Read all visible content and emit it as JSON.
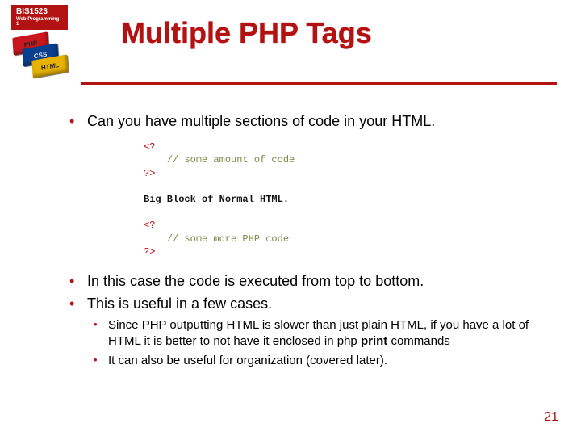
{
  "course": {
    "code": "BIS1523",
    "subtitle": "Web Programming 1"
  },
  "logo_bricks": [
    "PHP",
    "CSS",
    "HTML"
  ],
  "title": "Multiple PHP Tags",
  "bullets": {
    "b1": "Can you have multiple sections of code in your HTML.",
    "b2": "In this case the code is executed from top to bottom.",
    "b3": "This is useful in a few cases.",
    "sub1_pre": "Since PHP outputting HTML is slower than just plain HTML, if you have a lot of HTML it is better to not have it enclosed in php ",
    "sub1_bold": "print",
    "sub1_post": " commands",
    "sub2": "It can also be useful for organization (covered later)."
  },
  "code": {
    "open": "<?",
    "close": "?>",
    "comment1": "// some amount of code",
    "htmlLine": "Big Block of Normal HTML.",
    "comment2": "// some more PHP code"
  },
  "page_number": "21"
}
